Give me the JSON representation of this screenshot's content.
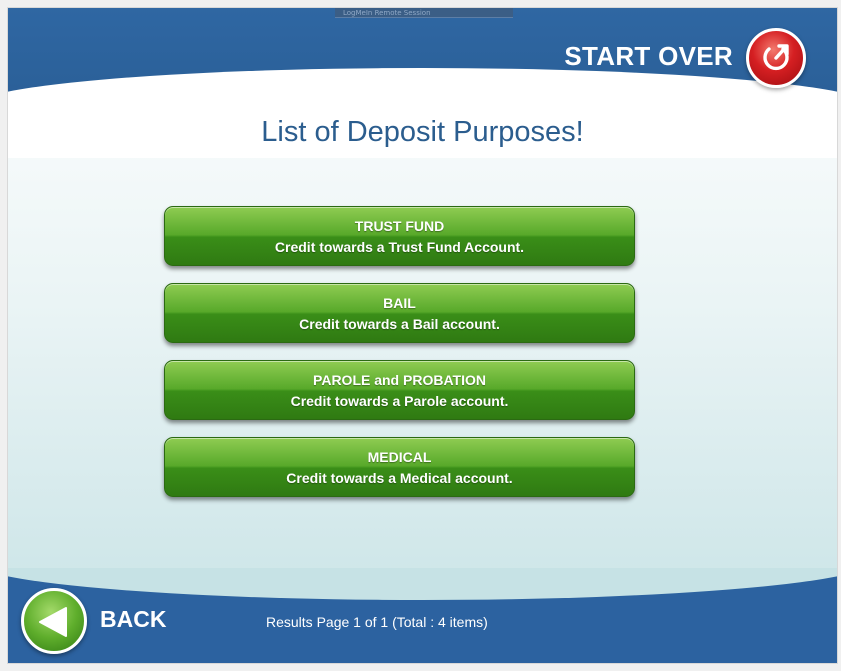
{
  "remote_bar": {
    "text": "LogMeIn  Remote Session"
  },
  "header": {
    "start_over_label": "START OVER",
    "start_over_icon": "restart-icon"
  },
  "title": "List of Deposit Purposes!",
  "purposes": [
    {
      "title": "TRUST FUND",
      "description": "Credit towards a Trust Fund Account."
    },
    {
      "title": "BAIL",
      "description": "Credit towards a Bail account."
    },
    {
      "title": "PAROLE and PROBATION",
      "description": "Credit towards a Parole account."
    },
    {
      "title": "MEDICAL",
      "description": "Credit towards a Medical account."
    }
  ],
  "footer": {
    "back_label": "BACK",
    "back_icon": "left-arrow-icon",
    "results": "Results Page 1 of 1 (Total : 4 items)"
  },
  "colors": {
    "header_blue": "#2f67a3",
    "button_green": "#58a92a",
    "start_over_red": "#d51f22",
    "title_blue": "#2b5d8e"
  }
}
